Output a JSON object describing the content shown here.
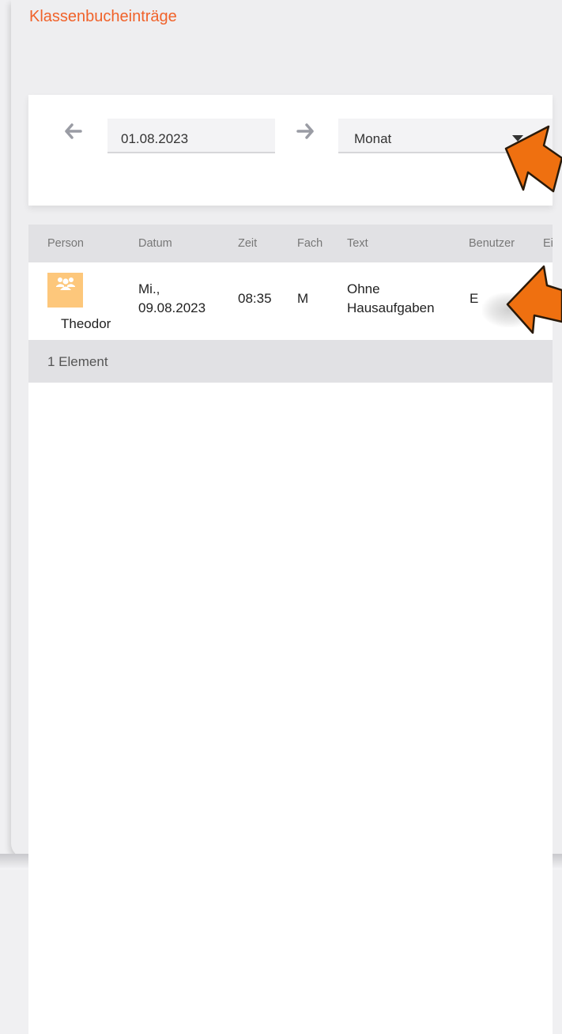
{
  "page": {
    "title": "Klassenbucheinträge"
  },
  "filter": {
    "date": "01.08.2023",
    "period": "Monat",
    "prev_icon": "arrow-left-icon",
    "next_icon": "arrow-right-icon",
    "dropdown_icon": "caret-down-icon"
  },
  "table": {
    "columns": [
      "Person",
      "Datum",
      "Zeit",
      "Fach",
      "Text",
      "Benutzer",
      "Ei"
    ],
    "rows": [
      {
        "person": "Theodor",
        "avatar_icon": "group-icon",
        "date_line1": "Mi.,",
        "date_line2": "09.08.2023",
        "time": "08:35",
        "subject": "M",
        "text_line1": "Ohne",
        "text_line2": "Hausaufgaben",
        "user": "E"
      }
    ],
    "footer": "1 Element"
  },
  "colors": {
    "accent": "#f0622a",
    "avatar_bg": "#fdc77b",
    "annotation_arrow": "#ef7010"
  }
}
